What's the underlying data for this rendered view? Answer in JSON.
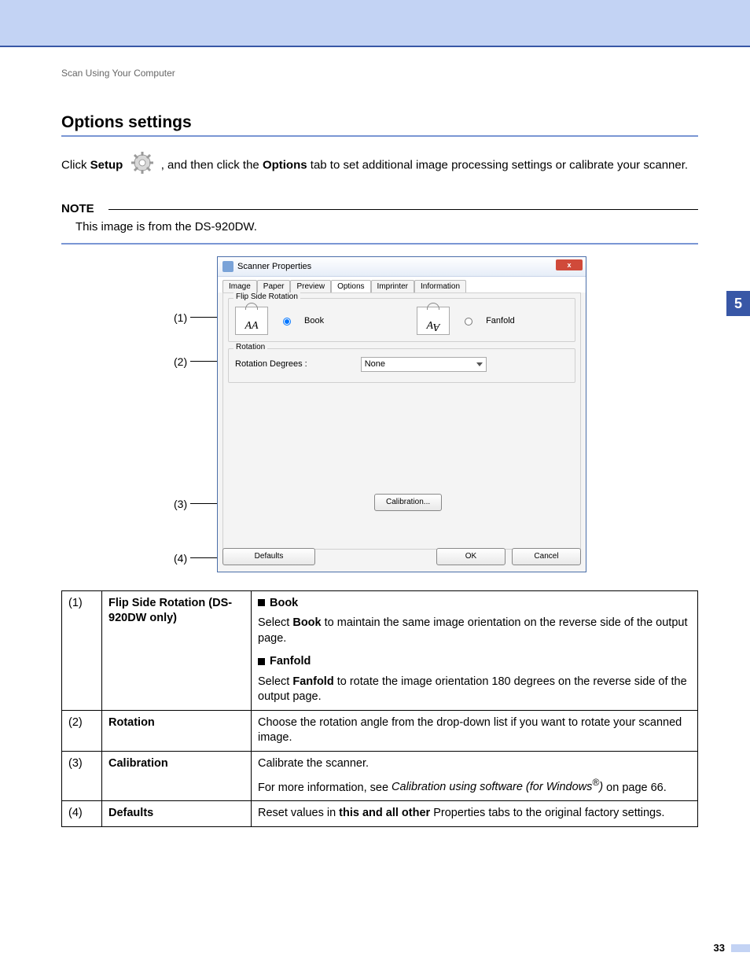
{
  "breadcrumb": "Scan Using Your Computer",
  "heading": "Options settings",
  "intro": {
    "pre": "Click ",
    "setup": "Setup",
    "mid": " , and then click the ",
    "options": "Options",
    "post": " tab to set additional image processing settings or calibrate your scanner."
  },
  "note": {
    "label": "NOTE",
    "text": "This image is from the DS-920DW."
  },
  "sideTab": "5",
  "pageNum": "33",
  "callouts": {
    "c1": "(1)",
    "c2": "(2)",
    "c3": "(3)",
    "c4": "(4)"
  },
  "dialog": {
    "title": "Scanner Properties",
    "close": "x",
    "tabs": {
      "image": "Image",
      "paper": "Paper",
      "preview": "Preview",
      "options": "Options",
      "imprinter": "Imprinter",
      "information": "Information"
    },
    "flip": {
      "legend": "Flip Side Rotation",
      "book": "Book",
      "fanfold": "Fanfold"
    },
    "rotation": {
      "legend": "Rotation",
      "label": "Rotation Degrees :",
      "value": "None"
    },
    "buttons": {
      "calibration": "Calibration...",
      "defaults": "Defaults",
      "ok": "OK",
      "cancel": "Cancel"
    }
  },
  "table": {
    "r1": {
      "n": "(1)",
      "label": "Flip Side Rotation (DS-920DW only)",
      "h1": "Book",
      "p1a": "Select ",
      "p1b": "Book",
      "p1c": " to maintain the same image orientation on the reverse side of the output page.",
      "h2": "Fanfold",
      "p2a": "Select ",
      "p2b": "Fanfold",
      "p2c": " to rotate the image orientation 180 degrees on the reverse side of the output page."
    },
    "r2": {
      "n": "(2)",
      "label": "Rotation",
      "text": "Choose the rotation angle from the drop-down list if you want to rotate your scanned image."
    },
    "r3": {
      "n": "(3)",
      "label": "Calibration",
      "line1": "Calibrate the scanner.",
      "l2a": "For more information, see ",
      "l2b": "Calibration using software (for Windows",
      "l2sup": "®",
      "l2c": ")",
      "l2d": " on page 66."
    },
    "r4": {
      "n": "(4)",
      "label": "Defaults",
      "a": "Reset values in ",
      "b": "this and all other",
      "c": " Properties tabs to the original factory settings."
    }
  }
}
